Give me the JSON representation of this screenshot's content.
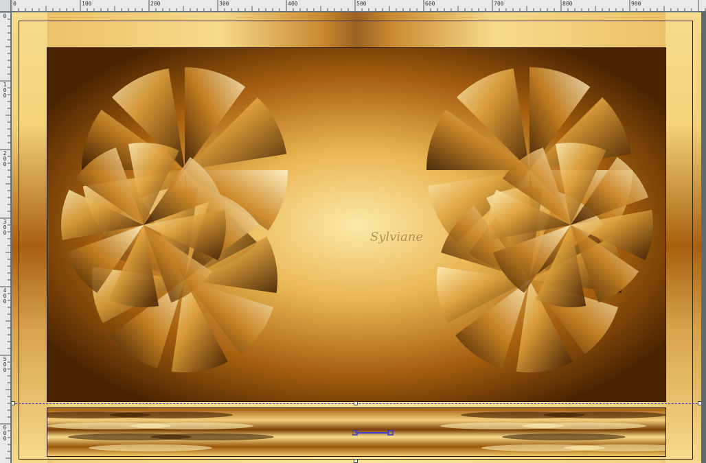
{
  "ruler_top": {
    "labels": [
      "0",
      "100",
      "200",
      "300",
      "400",
      "500",
      "600",
      "700",
      "800",
      "900"
    ]
  },
  "ruler_left": {
    "labels": [
      "0",
      "1\n0\n0",
      "2\n0\n0",
      "3\n0\n0",
      "4\n0\n0",
      "5\n0\n0",
      "6\n0\n0"
    ]
  },
  "watermark": {
    "text": "Sylviane"
  },
  "colors": {
    "accent_gold": "#e9b64f",
    "dark_bronze": "#5a2e02",
    "light_gold": "#f9df92",
    "selection": "#3b3bd4"
  },
  "icons": {
    "ruler_corner": "ruler-origin-icon",
    "move_handle": "move-handle-icon"
  }
}
